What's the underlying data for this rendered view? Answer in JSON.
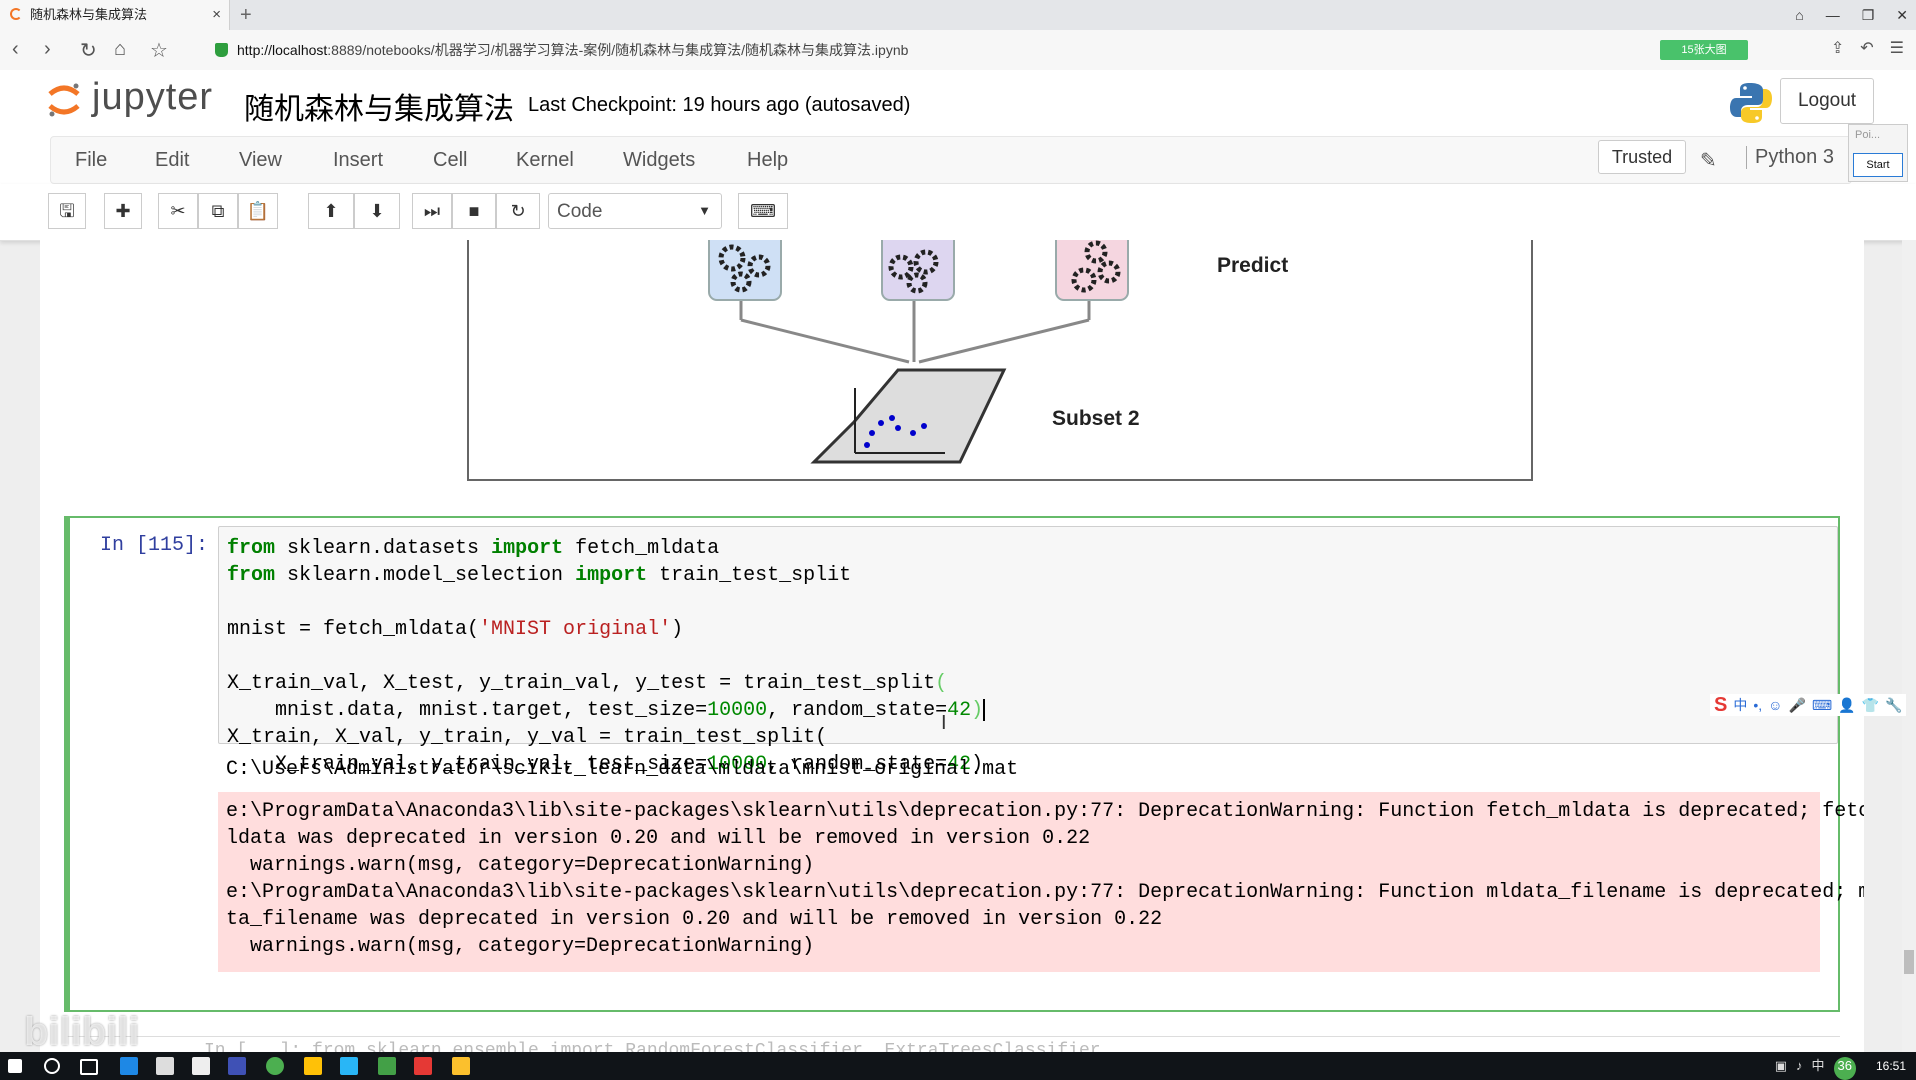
{
  "browser": {
    "tab_title": "随机森林与集成算法",
    "tab_close": "×",
    "new_tab": "+",
    "url_host": "http://localhost",
    "url_rest": ":8889/notebooks/机器学习/机器学习算法-案例/随机森林与集成算法/随机森林与集成算法.ipynb",
    "extension_label": "15张大图",
    "window_buttons": [
      "⌂",
      "—",
      "❐",
      "✕"
    ]
  },
  "header": {
    "logo_text": "jupyter",
    "notebook_name": "随机森林与集成算法",
    "checkpoint": "Last Checkpoint: 19 hours ago (autosaved)",
    "logout_label": "Logout"
  },
  "menu": {
    "items": [
      "File",
      "Edit",
      "View",
      "Insert",
      "Cell",
      "Kernel",
      "Widgets",
      "Help"
    ],
    "trusted": "Trusted",
    "kernel": "Python 3"
  },
  "popup": {
    "text": "Poi...",
    "button": "Start"
  },
  "toolbar": {
    "cell_type": "Code"
  },
  "diagram": {
    "predict_label": "Predict",
    "subset_label": "Subset 2",
    "colors": {
      "box1": "#cfe0f5",
      "box2": "#ddd6f0",
      "box3": "#f5d6e0"
    }
  },
  "cell": {
    "prompt": "In [115]:",
    "stdout": "C:\\Users\\Administrator\\scikit_learn_data\\mldata\\mnist-original.mat",
    "stderr": [
      "e:\\ProgramData\\Anaconda3\\lib\\site-packages\\sklearn\\utils\\deprecation.py:77: DeprecationWarning: Function fetch_mldata is deprecated; fetch_m",
      "ldata was deprecated in version 0.20 and will be removed in version 0.22",
      "  warnings.warn(msg, category=DeprecationWarning)",
      "e:\\ProgramData\\Anaconda3\\lib\\site-packages\\sklearn\\utils\\deprecation.py:77: DeprecationWarning: Function mldata_filename is deprecated; mlda",
      "ta_filename was deprecated in version 0.20 and will be removed in version 0.22",
      "  warnings.warn(msg, category=DeprecationWarning)"
    ]
  },
  "next_cell_hint": "In [...]: from sklearn.ensemble import RandomForestClassifier, ExtraTreesClassifier",
  "watermark": "bilibili",
  "taskbar": {
    "clock": "16:51",
    "tray_items": [
      "中",
      "36"
    ]
  }
}
